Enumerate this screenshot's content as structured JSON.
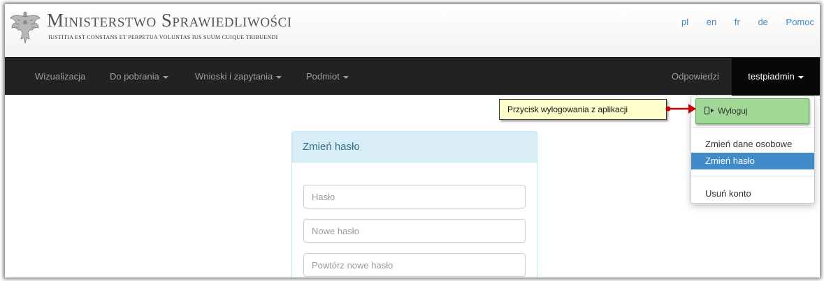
{
  "header": {
    "title": "Ministerstwo Sprawiedliwości",
    "motto": "Iustitia est constans et perpetua voluntas ius suum cuique tribuendi",
    "languages": [
      "pl",
      "en",
      "fr",
      "de"
    ],
    "help": "Pomoc"
  },
  "nav": {
    "items": [
      {
        "label": "Wizualizacja"
      },
      {
        "label": "Do pobrania"
      },
      {
        "label": "Wnioski i zapytania"
      },
      {
        "label": "Podmiot"
      }
    ],
    "responses": "Odpowiedzi",
    "user": "testpiadmin"
  },
  "dropdown": {
    "logout": "Wyloguj",
    "items": [
      "Zmień dane osobowe",
      "Zmień hasło",
      "Usuń konto"
    ],
    "active_item": "Zmień hasło"
  },
  "callout": {
    "text": "Przycisk wylogowania z aplikacji"
  },
  "panel": {
    "title": "Zmień hasło",
    "fields": [
      {
        "placeholder": "Hasło"
      },
      {
        "placeholder": "Nowe hasło"
      },
      {
        "placeholder": "Powtórz nowe hasło"
      }
    ]
  },
  "colors": {
    "navbar": "#222222",
    "link": "#428bca",
    "active_item": "#428bca",
    "logout_highlight": "#a0d995",
    "panel_heading": "#d9edf7",
    "callout": "#ffffcc",
    "arrow": "#cc0000"
  },
  "icons": {
    "emblem": "polish-eagle-emblem",
    "logout": "sign-out-icon",
    "caret": "caret-down-icon"
  }
}
